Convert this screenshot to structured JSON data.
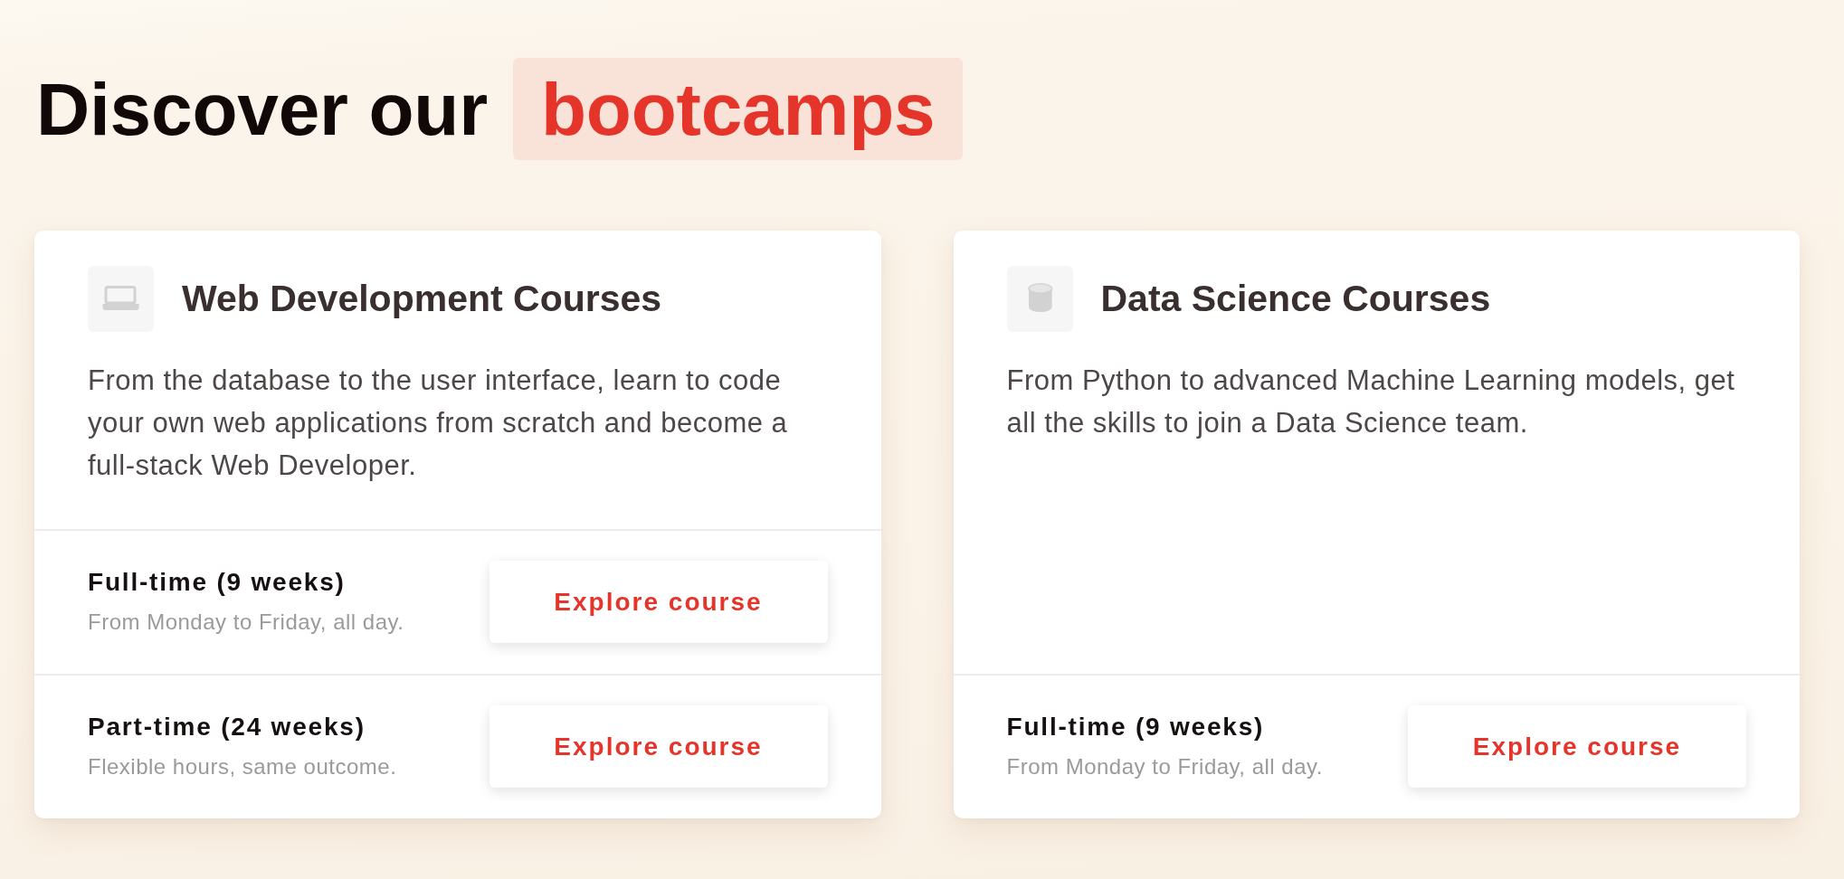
{
  "heading": {
    "text": "Discover our",
    "highlight": "bootcamps"
  },
  "cards": [
    {
      "title": "Web Development Courses",
      "description": "From the database to the user interface, learn to code your own web applications from scratch and become a full-stack Web Developer.",
      "courses": [
        {
          "title": "Full-time (9 weeks)",
          "schedule": "From Monday to Friday, all day.",
          "button": "Explore course"
        },
        {
          "title": "Part-time (24 weeks)",
          "schedule": "Flexible hours, same outcome.",
          "button": "Explore course"
        }
      ]
    },
    {
      "title": "Data Science Courses",
      "description": "From Python to advanced Machine Learning models, get all the skills to join a Data Science team.",
      "courses": [
        {
          "title": "Full-time (9 weeks)",
          "schedule": "From Monday to Friday, all day.",
          "button": "Explore course"
        }
      ]
    }
  ]
}
